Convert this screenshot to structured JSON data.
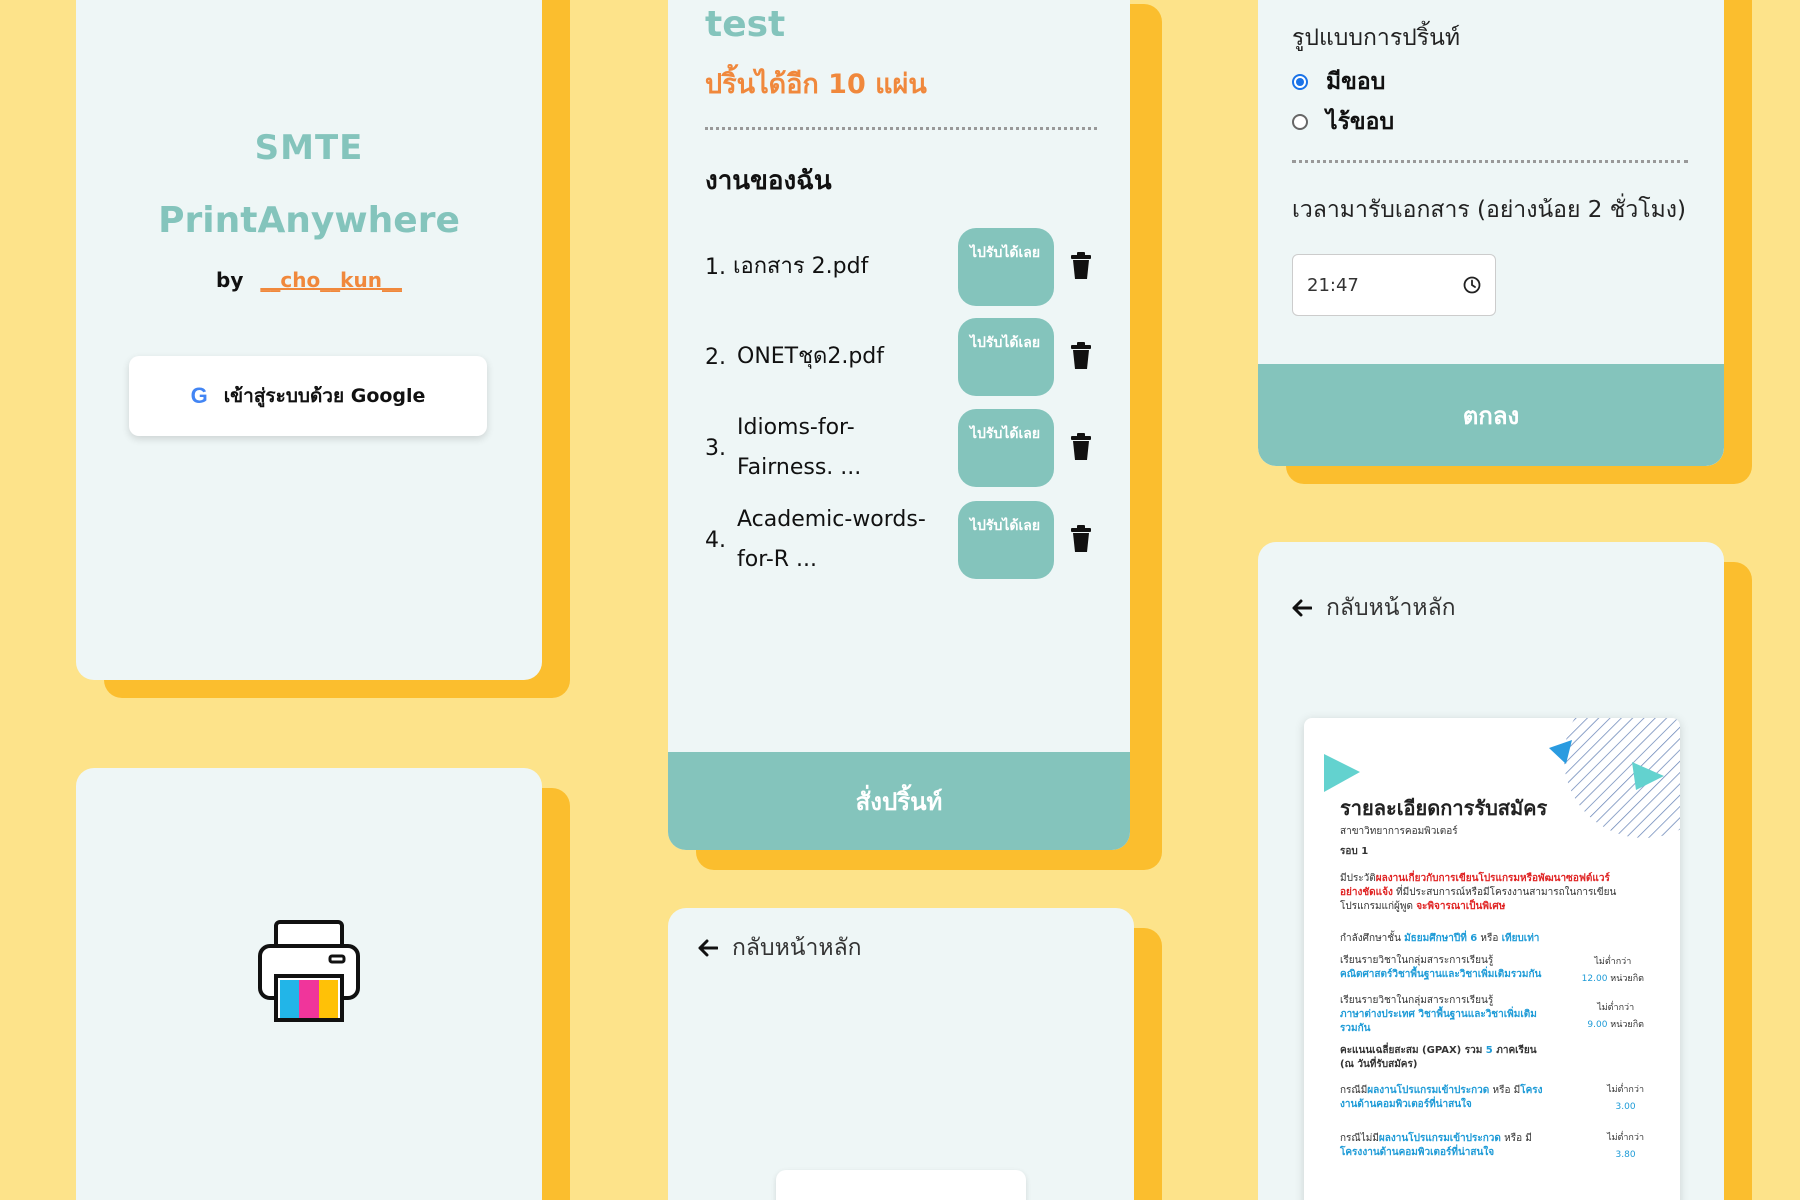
{
  "login": {
    "brand_line1": "SMTE",
    "brand_line2": "PrintAnywhere",
    "by_label": "by",
    "author": "__cho__kun__",
    "google_button_label": "เข้าสู่ระบบด้วย Google",
    "google_icon_letter": "G"
  },
  "jobs": {
    "title": "test",
    "quota": "ปริ้นได้อีก 10 แผ่น",
    "section_title": "งานของฉัน",
    "items": [
      {
        "num": "1.",
        "name": "เอกสาร 2.pdf",
        "status": "ไปรับได้เลย"
      },
      {
        "num": "2.",
        "name": "ONETชุด2.pdf",
        "status": "ไปรับได้เลย"
      },
      {
        "num": "3.",
        "name": "Idioms-for-Fairness. ...",
        "status": "ไปรับได้เลย"
      },
      {
        "num": "4.",
        "name": "Academic-words-for-R ...",
        "status": "ไปรับได้เลย"
      }
    ],
    "order_button_label": "สั่งปริ้นท์"
  },
  "back_home_label": "กลับหน้าหลัก",
  "settings": {
    "format_label": "รูปแบบการปริ้นท์",
    "options": [
      {
        "label": "มีขอบ",
        "selected": true
      },
      {
        "label": "ไร้ขอบ",
        "selected": false
      }
    ],
    "pickup_label": "เวลามารับเอกสาร (อย่างน้อย 2 ชั่วโมง)",
    "pickup_time": "21:47",
    "ok_button_label": "ตกลง"
  },
  "preview": {
    "back_label": "กลับหน้าหลัก",
    "doc_title": "รายละเอียดการรับสมัคร",
    "doc_subtitle": "สาขาวิทยาการคอมพิวเตอร์",
    "doc_round": "รอบ 1",
    "line1_prefix": "มีประวัติ",
    "line1_red": "ผลงานเกี่ยวกับการเขียนโปรแกรมหรือพัฒนาซอฟต์แวร์",
    "line2_red": "อย่างชัดแจ้ง",
    "line2_rest": " ที่มีประสบการณ์หรือมีโครงงานสามารถในการเขียน",
    "line3_prefix": "โปรแกรมแก่ผู้พูด ",
    "line3_red": "จะพิจารณาเป็นพิเศษ",
    "grade_prefix": "กำลังศึกษาชั้น ",
    "grade_blue": "มัธยมศึกษาปีที่ 6",
    "grade_mid": " หรือ ",
    "grade_blue2": "เทียบเท่า",
    "req1_prefix": "เรียนรายวิชาในกลุ่มสาระการเรียนรู้",
    "req1_blue": "คณิตศาสตร์วิชาพื้นฐานและวิชาเพิ่มเติมรวมกัน",
    "req1_min": "ไม่ต่ำกว่า",
    "req1_value": "12.00",
    "req1_unit": " หน่วยกิต",
    "req2_prefix": "เรียนรายวิชาในกลุ่มสาระการเรียนรู้",
    "req2_blue": "ภาษาต่างประเทศ วิชาพื้นฐานและวิชาเพิ่มเติม",
    "req2_blue2": "รวมกัน",
    "req2_min": "ไม่ต่ำกว่า",
    "req2_value": "9.00",
    "req2_unit": " หน่วยกิต",
    "gpax_prefix": "คะแนนเฉลี่ยสะสม (GPAX) รวม ",
    "gpax_blue": "5",
    "gpax_suffix": " ภาคเรียน",
    "gpax_note": "(ณ วันที่รับสมัคร)",
    "case1_prefix": "กรณีมี",
    "case1_blue": "ผลงานโปรแกรมเข้าประกวด",
    "case1_mid": " หรือ มี",
    "case1_blue2": "โครง",
    "case1_blue3": "งานด้านคอมพิวเตอร์ที่น่าสนใจ",
    "case1_min": "ไม่ต่ำกว่า",
    "case1_value": "3.00",
    "case2_prefix": "กรณีไม่มี",
    "case2_blue": "ผลงานโปรแกรมเข้าประกวด",
    "case2_mid": " หรือ มี",
    "case2_blue2": "โครงงานด้านคอมพิวเตอร์ที่น่าสนใจ",
    "case2_min": "ไม่ต่ำกว่า",
    "case2_value": "3.80"
  },
  "colors": {
    "background": "#FDE38A",
    "card": "#EEF6F6",
    "card_shadow": "#FBBE2E",
    "accent_teal": "#84C4BC",
    "accent_orange": "#F0883C"
  }
}
